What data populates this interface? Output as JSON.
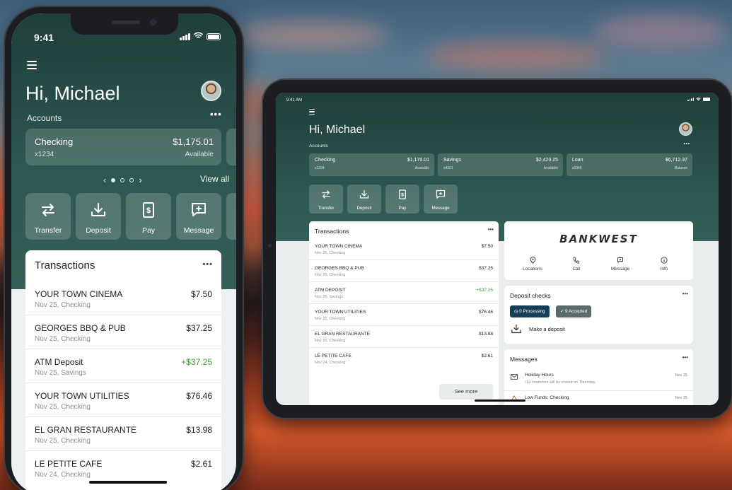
{
  "phone": {
    "status": {
      "time": "9:41"
    },
    "greeting": "Hi, Michael",
    "accounts_label": "Accounts",
    "account": {
      "name": "Checking",
      "number": "x1234",
      "amount": "$1,175.01",
      "sub": "Available"
    },
    "view_all": "View all",
    "actions": [
      {
        "label": "Transfer",
        "icon": "transfer-icon"
      },
      {
        "label": "Deposit",
        "icon": "deposit-icon"
      },
      {
        "label": "Pay",
        "icon": "pay-icon"
      },
      {
        "label": "Message",
        "icon": "message-icon"
      }
    ],
    "transactions_title": "Transactions",
    "transactions": [
      {
        "merchant": "YOUR TOWN CINEMA",
        "detail": "Nov 25, Checking",
        "amount": "$7.50"
      },
      {
        "merchant": "GEORGES BBQ & PUB",
        "detail": "Nov 25, Checking",
        "amount": "$37.25"
      },
      {
        "merchant": "ATM Deposit",
        "detail": "Nov 25, Savings",
        "amount": "+$37.25"
      },
      {
        "merchant": "YOUR TOWN UTILITIES",
        "detail": "Nov 25, Checking",
        "amount": "$76.46"
      },
      {
        "merchant": "EL GRAN RESTAURANTE",
        "detail": "Nov 25, Checking",
        "amount": "$13.98"
      },
      {
        "merchant": "LE PETITE CAFE",
        "detail": "Nov 24, Checking",
        "amount": "$2.61"
      }
    ]
  },
  "tablet": {
    "status": {
      "time": "9:41 AM"
    },
    "greeting": "Hi, Michael",
    "accounts_label": "Accounts",
    "accounts": [
      {
        "name": "Checking",
        "number": "x1234",
        "amount": "$1,175.01",
        "sub": "Available"
      },
      {
        "name": "Savings",
        "number": "x4321",
        "amount": "$2,423.25",
        "sub": "Available"
      },
      {
        "name": "Loan",
        "number": "x2345",
        "amount": "$6,712.37",
        "sub": "Balance"
      }
    ],
    "actions": [
      "Transfer",
      "Deposit",
      "Pay",
      "Message"
    ],
    "transactions_title": "Transactions",
    "transactions": [
      {
        "merchant": "YOUR TOWN CINEMA",
        "detail": "Nov 25, Checking",
        "amount": "$7.50"
      },
      {
        "merchant": "GEORGES BBQ & PUB",
        "detail": "Nov 25, Checking",
        "amount": "$37.25"
      },
      {
        "merchant": "ATM DEPOSIT",
        "detail": "Nov 25, Savings",
        "amount": "+$37.25"
      },
      {
        "merchant": "YOUR TOWN UTILITIES",
        "detail": "Nov 25, Checking",
        "amount": "$76.46"
      },
      {
        "merchant": "EL GRAN RESTAURANTE",
        "detail": "Nov 25, Checking",
        "amount": "$13.98"
      },
      {
        "merchant": "LE PETITE CAFE",
        "detail": "Nov 24, Checking",
        "amount": "$2.61"
      }
    ],
    "see_more": "See more",
    "bank_name": "BANKWEST",
    "quick_links": [
      "Locations",
      "Call",
      "Message",
      "Info"
    ],
    "deposit_checks": {
      "title": "Deposit checks",
      "processing": "0 Processing",
      "accepted": "9 Accepted",
      "make_deposit": "Make a deposit"
    },
    "messages": {
      "title": "Messages",
      "items": [
        {
          "title": "Holiday Hours",
          "sub": "Our branches will be closed on Thursday.",
          "date": "Nov 25"
        },
        {
          "title": "Low Funds: Checking",
          "sub": "",
          "date": "Nov 25"
        }
      ]
    }
  },
  "colors": {
    "brand_dark": "#1f3e3a",
    "brand_mid": "#2e5852",
    "positive": "#3d9a3a",
    "processing_pill": "#163f57",
    "accepted_pill": "#5c6a6c"
  }
}
